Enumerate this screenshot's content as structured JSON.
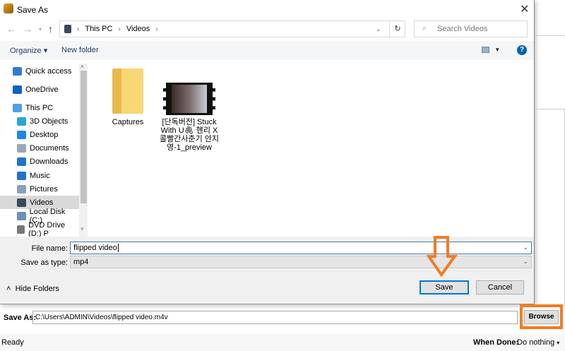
{
  "dialog": {
    "title": "Save As",
    "close_icon": "close-icon"
  },
  "nav": {
    "path": [
      "This PC",
      "Videos"
    ],
    "search_placeholder": "Search Videos"
  },
  "toolbar": {
    "organize": "Organize",
    "new_folder": "New folder"
  },
  "sidebar": {
    "items": [
      {
        "label": "Quick access",
        "icon": "star-icon",
        "color": "#2b7cd3"
      },
      {
        "label": "OneDrive",
        "icon": "cloud-icon",
        "color": "#0a64c8"
      },
      {
        "label": "This PC",
        "icon": "computer-icon",
        "color": "#4fa3e0"
      },
      {
        "label": "3D Objects",
        "icon": "cube-icon",
        "color": "#2aa6d6"
      },
      {
        "label": "Desktop",
        "icon": "desktop-icon",
        "color": "#1e88e5"
      },
      {
        "label": "Documents",
        "icon": "document-icon",
        "color": "#9aa7b5"
      },
      {
        "label": "Downloads",
        "icon": "download-icon",
        "color": "#1e74c9"
      },
      {
        "label": "Music",
        "icon": "music-icon",
        "color": "#1e74c9"
      },
      {
        "label": "Pictures",
        "icon": "pictures-icon",
        "color": "#8aa0b8"
      },
      {
        "label": "Videos",
        "icon": "video-icon",
        "color": "#3a4a5a",
        "selected": true
      },
      {
        "label": "Local Disk (C:)",
        "icon": "disk-icon",
        "color": "#6b8fb5"
      },
      {
        "label": "DVD Drive (D:) P",
        "icon": "dvd-icon",
        "color": "#777777"
      }
    ]
  },
  "files": [
    {
      "name": "Captures",
      "type": "folder"
    },
    {
      "name": "[단독버전] Stuck With U🖇 헨리 X 콜빨간사춘기 안지영-1_preview",
      "type": "video"
    }
  ],
  "form": {
    "file_name_label": "File name:",
    "file_name": "flipped video",
    "type_label": "Save as type:",
    "type": "mp4",
    "hide_folders": "Hide Folders",
    "save": "Save",
    "cancel": "Cancel"
  },
  "app": {
    "save_as_label": "Save As:",
    "save_as_path": "C:\\Users\\ADMIN\\Videos\\flipped video.m4v",
    "browse": "Browse",
    "status": "Ready",
    "when_done_label": "When Done:",
    "when_done": "Do nothing"
  },
  "colors": {
    "highlight": "#f47b20",
    "accent": "#0078d7"
  }
}
